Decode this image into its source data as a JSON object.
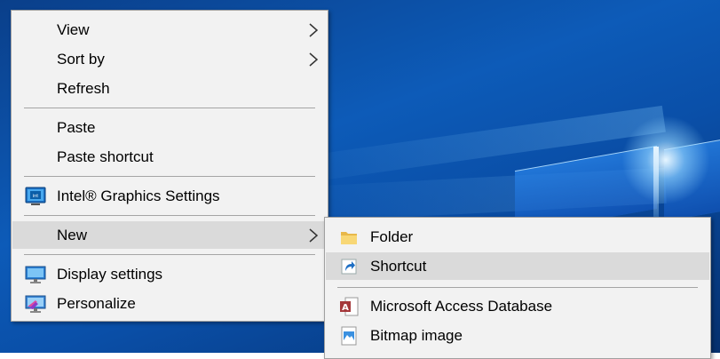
{
  "context_menu": {
    "items": [
      {
        "label": "View",
        "has_submenu": true
      },
      {
        "label": "Sort by",
        "has_submenu": true
      },
      {
        "label": "Refresh",
        "has_submenu": false
      },
      {
        "label": "Paste",
        "has_submenu": false
      },
      {
        "label": "Paste shortcut",
        "has_submenu": false
      },
      {
        "label": "Intel® Graphics Settings",
        "icon": "intel-graphics-icon",
        "has_submenu": false
      },
      {
        "label": "New",
        "has_submenu": true,
        "highlighted": true
      },
      {
        "label": "Display settings",
        "icon": "display-icon",
        "has_submenu": false
      },
      {
        "label": "Personalize",
        "icon": "personalize-icon",
        "has_submenu": false
      }
    ]
  },
  "new_submenu": {
    "items": [
      {
        "label": "Folder",
        "icon": "folder-icon"
      },
      {
        "label": "Shortcut",
        "icon": "shortcut-icon",
        "highlighted": true
      },
      {
        "label": "Microsoft Access Database",
        "icon": "access-database-icon"
      },
      {
        "label": "Bitmap image",
        "icon": "bitmap-image-icon"
      }
    ]
  },
  "colors": {
    "menu_background": "#f2f2f2",
    "highlight": "#dadada",
    "separator": "#a5a5a5",
    "desktop_blue": "#0d5bb8"
  }
}
